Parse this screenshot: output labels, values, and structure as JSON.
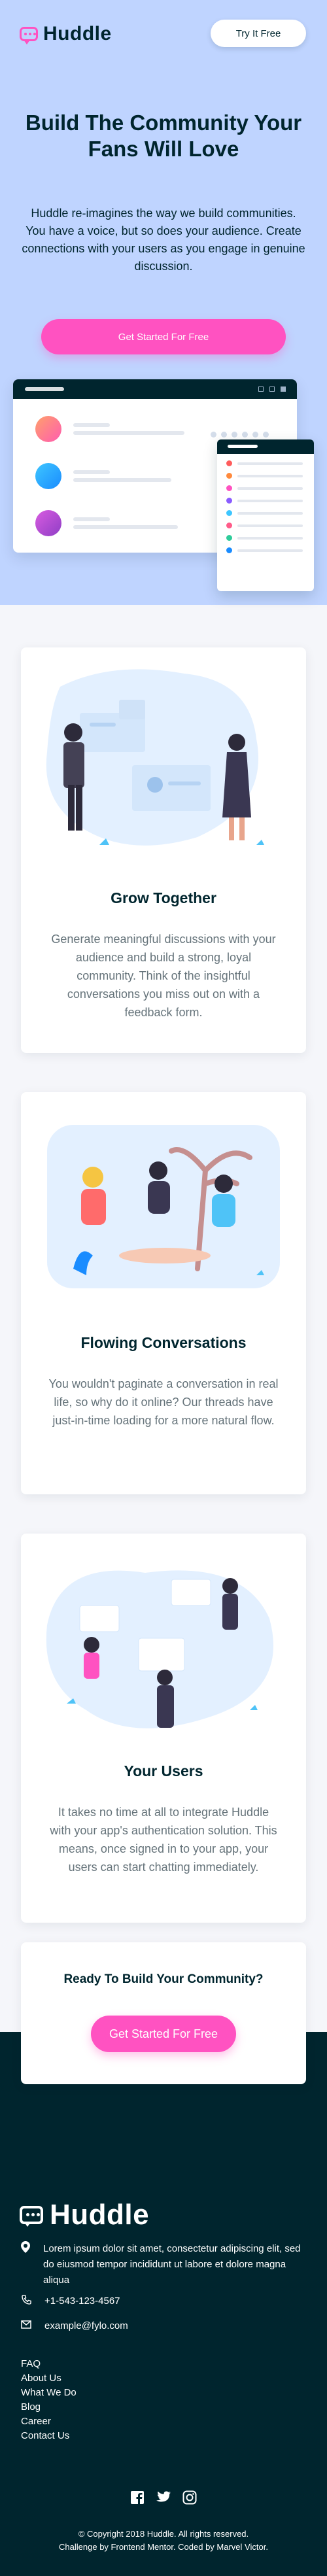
{
  "brand": {
    "name": "Huddle"
  },
  "header": {
    "try_label": "Try It Free"
  },
  "hero": {
    "title": "Build The Community Your Fans Will Love",
    "text": "Huddle re-imagines the way we build communities. You have a voice, but so does your audience. Create connections with your users as you engage in genuine discussion.",
    "cta_label": "Get Started For Free"
  },
  "features": [
    {
      "title": "Grow Together",
      "text": "Generate meaningful discussions with your audience and build a strong, loyal community. Think of the insightful conversations you miss out on with a feedback form."
    },
    {
      "title": "Flowing Conversations",
      "text": "You wouldn't paginate a conversation in real life, so why do it online? Our threads have just-in-time loading for a more natural flow."
    },
    {
      "title": "Your Users",
      "text": "It takes no time at all to integrate Huddle with your app's authentication solution. This means, once signed in to your app, your users can start chatting immediately."
    }
  ],
  "ready": {
    "title": "Ready To Build Your Community?",
    "cta_label": "Get Started For Free"
  },
  "footer": {
    "address": "Lorem ipsum dolor sit amet, consectetur adipiscing elit, sed do eiusmod tempor incididunt ut labore et dolore magna aliqua",
    "phone": "+1-543-123-4567",
    "email": "example@fylo.com",
    "links": [
      "FAQ",
      "About Us",
      "What We Do",
      "Blog",
      "Career",
      "Contact Us"
    ],
    "copyright": "© Copyright 2018 Huddle. All rights reserved.",
    "credit": "Challenge by Frontend Mentor. Coded by Marvel Victor."
  },
  "colors": {
    "hero_bg": "#bfd4ff",
    "accent": "#ff52c1",
    "dark": "#00252e"
  },
  "icons": [
    "phone-icon",
    "email-icon",
    "location-icon",
    "facebook-icon",
    "twitter-icon",
    "instagram-icon"
  ]
}
